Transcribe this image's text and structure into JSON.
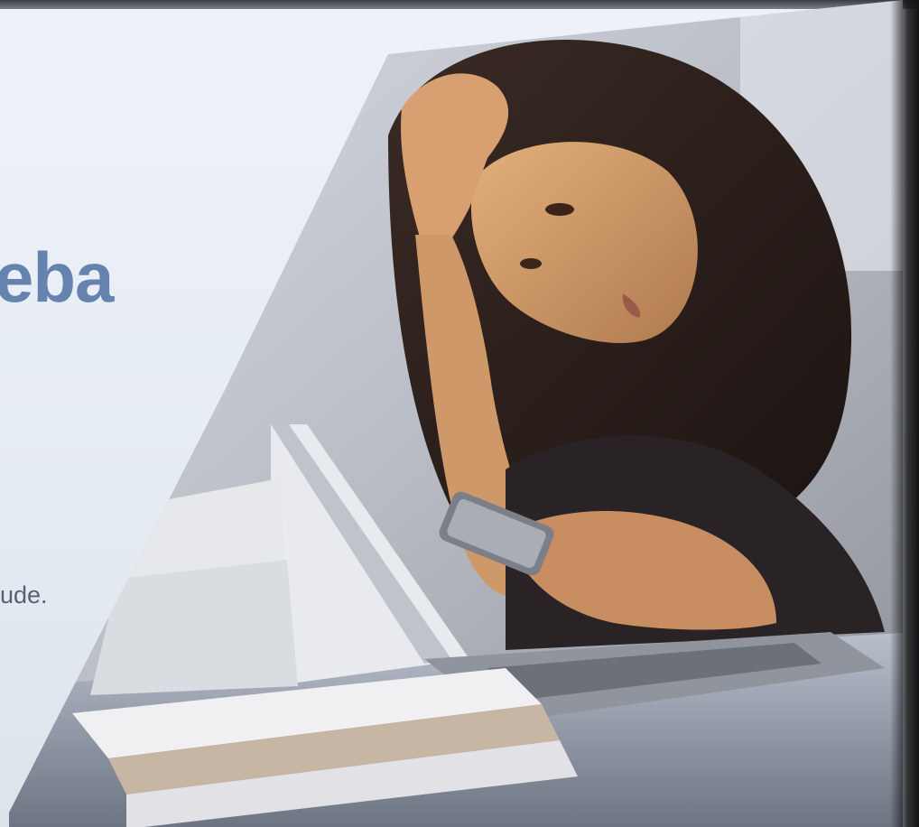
{
  "slide": {
    "headline_fragment": "eba",
    "body_fragment": "ude."
  },
  "photo": {
    "subject": "stressed-woman-with-phone-and-laptop-icon"
  },
  "colors": {
    "headline": "#5b79a8",
    "background": "#eef2f8"
  }
}
